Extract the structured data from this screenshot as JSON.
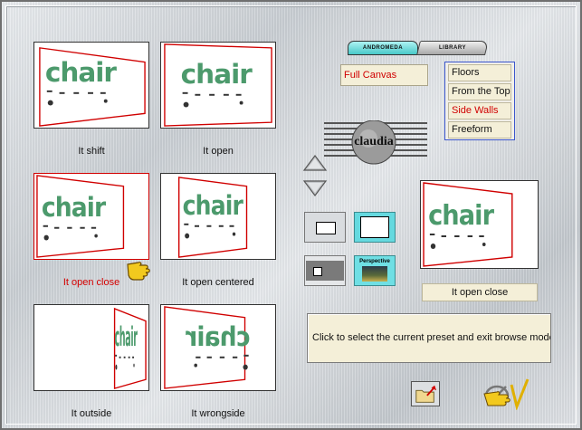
{
  "thumbnails": [
    {
      "label": "It shift",
      "selected": false
    },
    {
      "label": "It open",
      "selected": false
    },
    {
      "label": "It open close",
      "selected": true
    },
    {
      "label": "It open centered",
      "selected": false
    },
    {
      "label": "It outside",
      "selected": false
    },
    {
      "label": "It wrongside",
      "selected": false
    }
  ],
  "thumb_text": "chair",
  "tabs": {
    "andromeda": "ANDROMEDA",
    "library": "LIBRARY"
  },
  "canvas_option": "Full Canvas",
  "options": [
    "Floors",
    "From the Top",
    "Side Walls",
    "Freeform"
  ],
  "active_option": "Side Walls",
  "logo_text": "claudia",
  "perspective_label": "Perspective",
  "preview": {
    "name": "It open close"
  },
  "status_text": "Click to select the current preset and exit browse mode.",
  "colors": {
    "accent_red": "#d00000",
    "teal": "#65d9df",
    "panel": "#f4efd8",
    "frame_blue": "#3a55cc"
  },
  "icons": [
    "up-arrow-icon",
    "down-arrow-icon",
    "folder-export-icon",
    "pointing-hand-icon",
    "checkmark-icon"
  ]
}
